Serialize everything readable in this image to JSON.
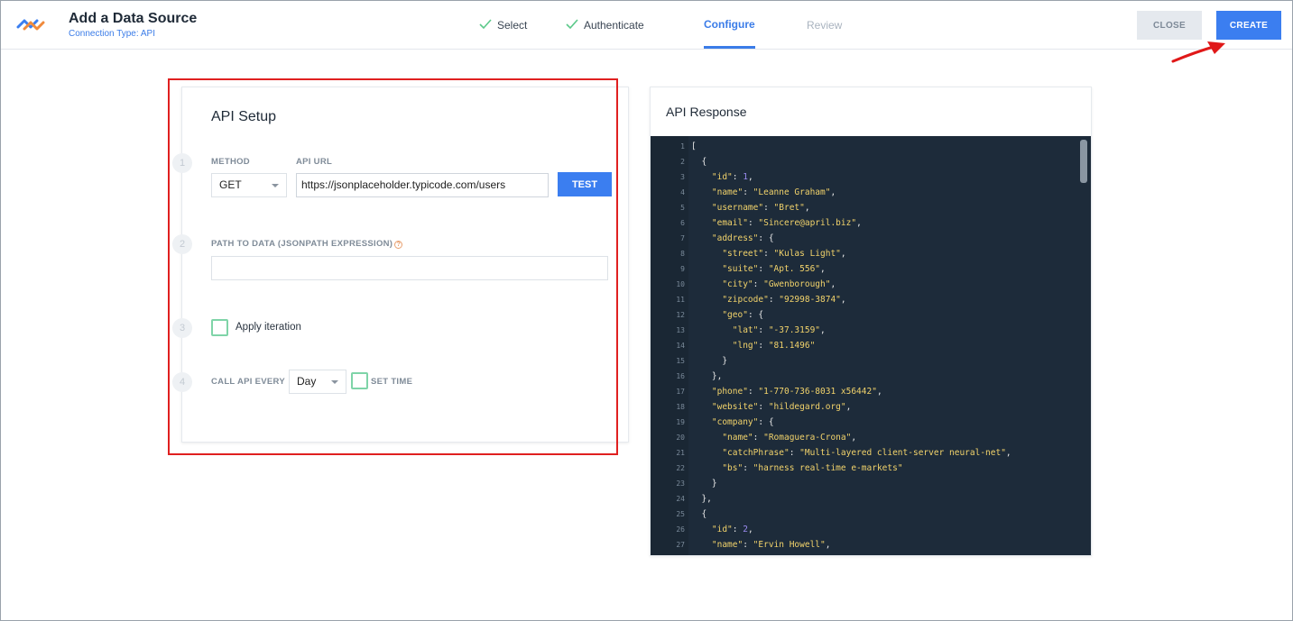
{
  "header": {
    "title": "Add a Data Source",
    "subtitle": "Connection Type: API",
    "steps": [
      {
        "label": "Select",
        "state": "done"
      },
      {
        "label": "Authenticate",
        "state": "done"
      },
      {
        "label": "Configure",
        "state": "active"
      },
      {
        "label": "Review",
        "state": "future"
      }
    ],
    "close_label": "CLOSE",
    "create_label": "CREATE"
  },
  "api_setup": {
    "title": "API Setup",
    "step_numbers": [
      "1",
      "2",
      "3",
      "4"
    ],
    "method_label": "METHOD",
    "method_value": "GET",
    "url_label": "API URL",
    "url_value": "https://jsonplaceholder.typicode.com/users",
    "test_label": "TEST",
    "path_label": "PATH TO DATA (JSONPATH EXPRESSION)",
    "path_value": "",
    "help_glyph": "?",
    "iteration_label": "Apply iteration",
    "call_label": "CALL API EVERY",
    "call_value": "Day",
    "set_time_label": "SET TIME"
  },
  "api_response": {
    "title": "API Response",
    "lines": [
      "[",
      "  {",
      "    \"id\": 1,",
      "    \"name\": \"Leanne Graham\",",
      "    \"username\": \"Bret\",",
      "    \"email\": \"Sincere@april.biz\",",
      "    \"address\": {",
      "      \"street\": \"Kulas Light\",",
      "      \"suite\": \"Apt. 556\",",
      "      \"city\": \"Gwenborough\",",
      "      \"zipcode\": \"92998-3874\",",
      "      \"geo\": {",
      "        \"lat\": \"-37.3159\",",
      "        \"lng\": \"81.1496\"",
      "      }",
      "    },",
      "    \"phone\": \"1-770-736-8031 x56442\",",
      "    \"website\": \"hildegard.org\",",
      "    \"company\": {",
      "      \"name\": \"Romaguera-Crona\",",
      "      \"catchPhrase\": \"Multi-layered client-server neural-net\",",
      "      \"bs\": \"harness real-time e-markets\"",
      "    }",
      "  },",
      "  {",
      "    \"id\": 2,",
      "    \"name\": \"Ervin Howell\","
    ]
  },
  "colors": {
    "accent": "#3b7ef0",
    "json_key": "#f2d36b",
    "json_string": "#f2d36b",
    "json_number": "#9b8cf0",
    "highlight_border": "#e02020"
  }
}
